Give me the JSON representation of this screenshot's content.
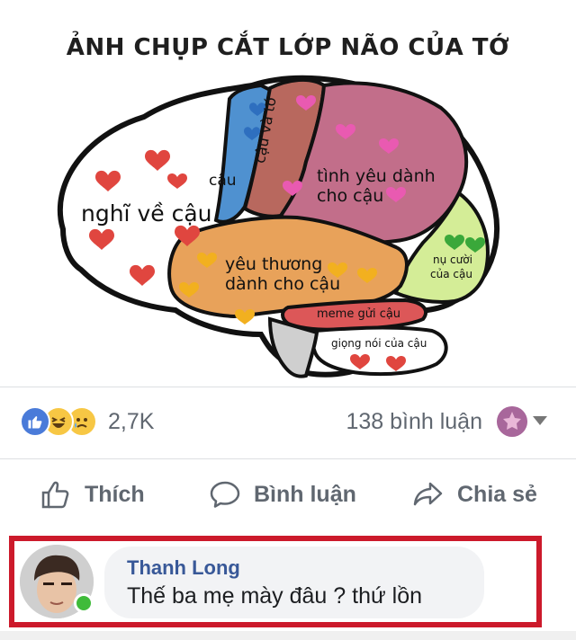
{
  "meme": {
    "title": "ẢNH CHỤP CẮT LỚP NÃO CỦA TỚ",
    "regions": {
      "nghi_ve_cau": "nghĩ về cậu",
      "cau": "cậu",
      "cau_va_to": "cậu và tớ",
      "tinh_yeu_line1": "tình yêu dành",
      "tinh_yeu_line2": "cho cậu",
      "yeu_thuong_line1": "yêu thương",
      "yeu_thuong_line2": "dành cho cậu",
      "nu_cuoi_line1": "nụ cười",
      "nu_cuoi_line2": "của cậu",
      "meme_gui_cau": "meme gửi cậu",
      "giong_noi": "giọng nói của cậu"
    }
  },
  "reactions": {
    "icons": [
      "like-icon",
      "haha-icon",
      "sad-icon"
    ],
    "count": "2,7K"
  },
  "comments_count": "138 bình luận",
  "actions": {
    "like": "Thích",
    "comment": "Bình luận",
    "share": "Chia sẻ"
  },
  "comment": {
    "author": "Thanh Long",
    "text": "Thế ba mẹ mày đâu ? thứ lồn",
    "highlight_color": "#cc1a2b",
    "online_color": "#3fbb3a"
  },
  "colors": {
    "like_blue": "#4a7bd9",
    "link_blue": "#385898",
    "muted_text": "#606770"
  }
}
